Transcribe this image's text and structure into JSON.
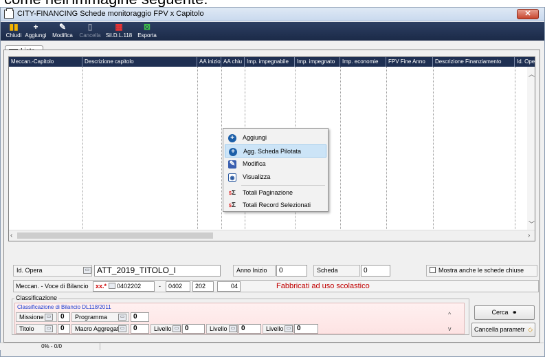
{
  "cropped_text": "come nell'immagine seguente:",
  "window": {
    "title": "CITY-FINANCING  Schede monitoraggio FPV x Capitolo",
    "close_label": "✕"
  },
  "toolbar": {
    "items": [
      {
        "label": "Chiudi",
        "icon": "▮▮"
      },
      {
        "label": "Aggiungi",
        "icon": "+"
      },
      {
        "label": "Modifica",
        "icon": "✎"
      },
      {
        "label": "Cancella",
        "icon": "▯"
      },
      {
        "label": "Sil.D.L.118",
        "icon": "▦"
      },
      {
        "label": "Esporta",
        "icon": "⊠"
      }
    ]
  },
  "tabs": [
    {
      "label": "Lista"
    }
  ],
  "grid": {
    "columns": [
      "Meccan.-Capitolo",
      "Descrizione capitolo",
      "AA inizio",
      "AA chiu",
      "Imp. impegnabile",
      "Imp. impegnato",
      "Imp. economie",
      "FPV Fine Anno",
      "Descrizione Finanziamento",
      "Id. Ope"
    ]
  },
  "context_menu": {
    "items": [
      "Aggiungi",
      "Agg. Scheda Pilotata",
      "Modifica",
      "Visualizza",
      "Totali Paginazione",
      "Totali Record Selezionati"
    ]
  },
  "filters": {
    "id_opera_label": "Id. Opera",
    "id_opera_value": "ATT_2019_TITOLO_I",
    "anno_inizio_label": "Anno Inizio",
    "anno_inizio_value": "0",
    "scheda_label": "Scheda",
    "scheda_value": "0",
    "mostra_label": "Mostra anche le schede chiuse",
    "meccan_label": "Meccan. - Voce di Bilancio",
    "meccan_prefix": "xx.*",
    "meccan_code": "0402202",
    "dash": "-",
    "meccan_p1": "0402",
    "meccan_p2": "202",
    "meccan_p3": "04",
    "meccan_desc": "Fabbricati ad uso scolastico",
    "classificazione_label": "Classificazione",
    "classificazione_sub": "Classificazione di Bilancio DL118/2011",
    "missione_label": "Missione",
    "missione_value": "0",
    "programma_label": "Programma",
    "programma_value": "0",
    "titolo_label": "Titolo",
    "titolo_value": "0",
    "macro_label": "Macro Aggregato",
    "macro_value": "0",
    "livello3_label": "Livello 3",
    "livello3_value": "0",
    "livello4_label": "Livello 4",
    "livello4_value": "0",
    "livello5_label": "Livello 5",
    "livello5_value": "0",
    "cerca_label": "Cerca",
    "cancella_label": "Cancella parametr"
  },
  "status": {
    "text": "0% - 0/0"
  },
  "colors": {
    "header_bg": "#1e2f52",
    "highlight": "#cce4f7",
    "desc_red": "#c00000"
  }
}
